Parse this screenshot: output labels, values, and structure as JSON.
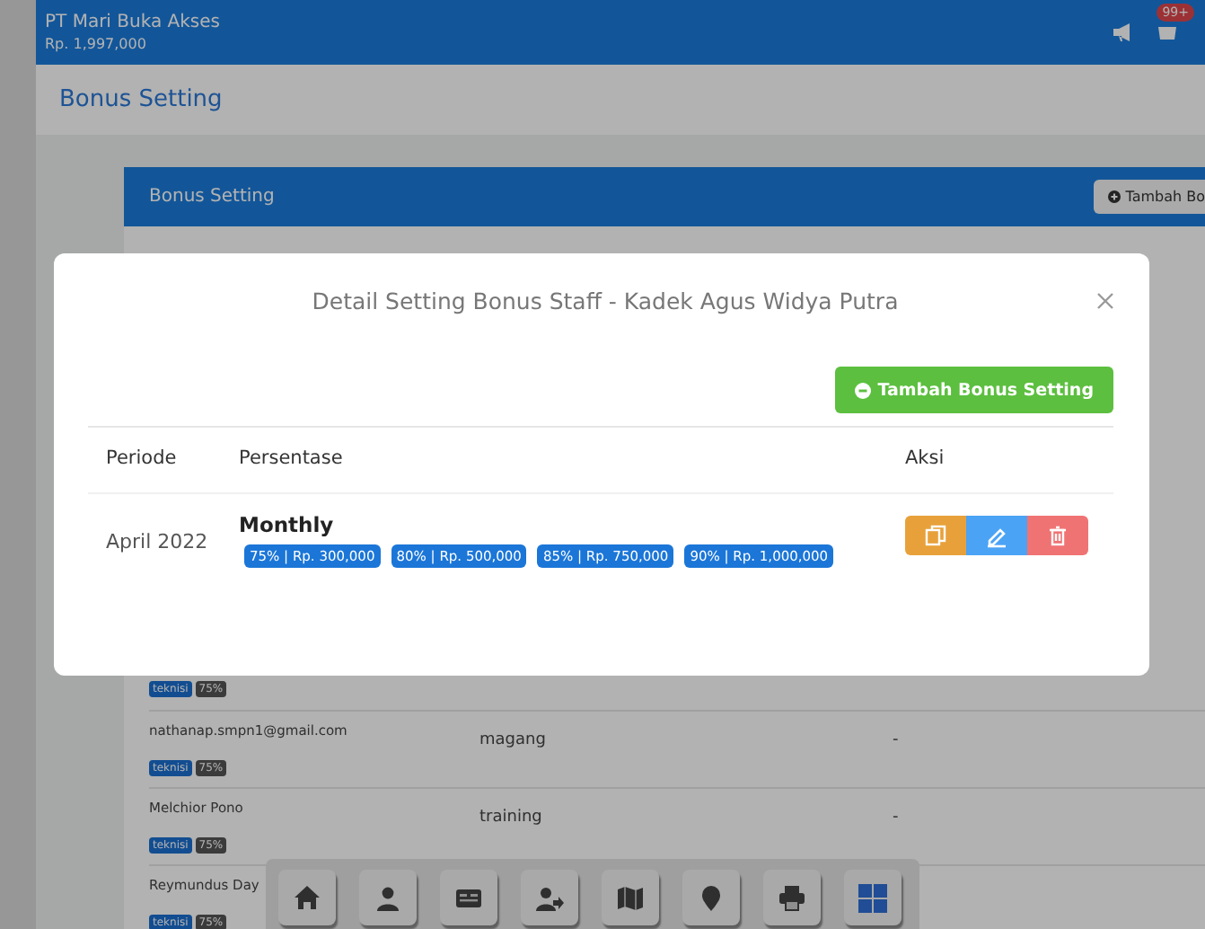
{
  "header": {
    "company": "PT Mari Buka Akses",
    "balance": "Rp. 1,997,000",
    "badge": "99+"
  },
  "page_title": "Bonus Setting",
  "card": {
    "title": "Bonus Setting",
    "add_button": "Tambah Bo"
  },
  "rows": [
    {
      "tags": [
        {
          "label": "teknisi",
          "kind": "role"
        },
        {
          "label": "75%",
          "kind": "level"
        }
      ]
    },
    {
      "name": "nathanap.smpn1@gmail.com",
      "role": "magang",
      "value": "-",
      "tags": [
        {
          "label": "teknisi",
          "kind": "role"
        },
        {
          "label": "75%",
          "kind": "level"
        }
      ]
    },
    {
      "name": "Melchior Pono",
      "role": "training",
      "value": "-",
      "tags": [
        {
          "label": "teknisi",
          "kind": "role"
        },
        {
          "label": "75%",
          "kind": "level"
        }
      ]
    },
    {
      "name": "Reymundus Day",
      "tags": [
        {
          "label": "teknisi",
          "kind": "role"
        },
        {
          "label": "75%",
          "kind": "level"
        }
      ]
    }
  ],
  "modal": {
    "title": "Detail Setting Bonus Staff - Kadek Agus Widya Putra",
    "add_button": "Tambah Bonus Setting",
    "columns": [
      "Periode",
      "Persentase",
      "Aksi"
    ],
    "rows": [
      {
        "period": "April 2022",
        "type": "Monthly",
        "tiers": [
          "75% | Rp. 300,000",
          "80% | Rp. 500,000",
          "85% | Rp. 750,000",
          "90% | Rp. 1,000,000"
        ],
        "actions": [
          {
            "kind": "copy"
          },
          {
            "kind": "edit"
          },
          {
            "kind": "delete"
          }
        ]
      }
    ]
  }
}
